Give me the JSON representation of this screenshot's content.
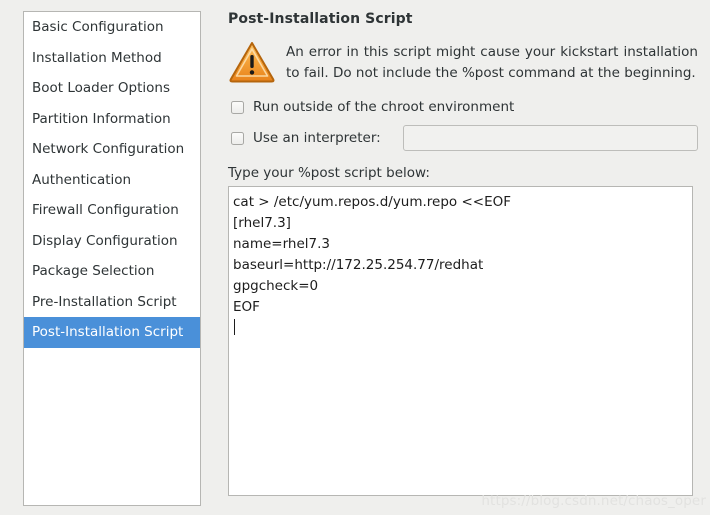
{
  "sidebar": {
    "items": [
      {
        "label": "Basic Configuration",
        "selected": false
      },
      {
        "label": "Installation Method",
        "selected": false
      },
      {
        "label": "Boot Loader Options",
        "selected": false
      },
      {
        "label": "Partition Information",
        "selected": false
      },
      {
        "label": "Network Configuration",
        "selected": false
      },
      {
        "label": "Authentication",
        "selected": false
      },
      {
        "label": "Firewall Configuration",
        "selected": false
      },
      {
        "label": "Display Configuration",
        "selected": false
      },
      {
        "label": "Package Selection",
        "selected": false
      },
      {
        "label": "Pre-Installation Script",
        "selected": false
      },
      {
        "label": "Post-Installation Script",
        "selected": true
      }
    ],
    "selected_color": "#4a90d9",
    "selected_text_color": "#ffffff"
  },
  "main": {
    "title": "Post-Installation Script",
    "warning": {
      "icon": "warning-triangle-icon",
      "icon_color": "#f0a030",
      "text": "An error in this script might cause your kickstart installation to fail. Do not include the %post command at the beginning."
    },
    "options": [
      {
        "label": "Run outside of the chroot environment",
        "checked": false
      },
      {
        "label": "Use an interpreter:",
        "checked": false
      }
    ],
    "interpreter_input": {
      "value": "",
      "placeholder": "",
      "enabled": false
    },
    "script_label": "Type your %post script below:",
    "script_lines": [
      "cat > /etc/yum.repos.d/yum.repo <<EOF",
      "[rhel7.3]",
      "name=rhel7.3",
      "baseurl=http://172.25.254.77/redhat",
      "gpgcheck=0",
      "EOF"
    ]
  },
  "watermark": {
    "text": "https://blog.csdn.net/chaos_oper",
    "color": "#e2e2e0"
  }
}
